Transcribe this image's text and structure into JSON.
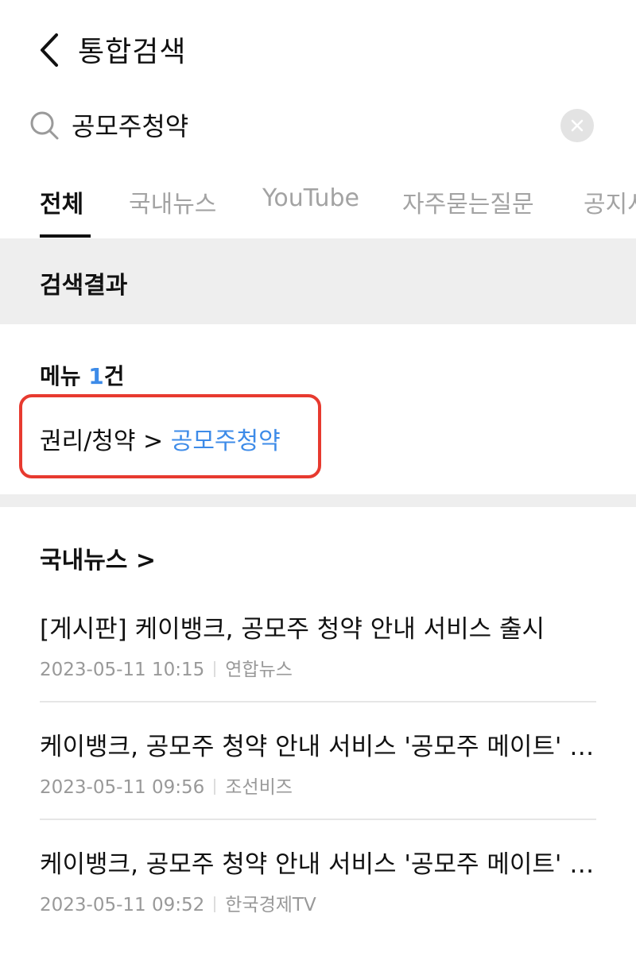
{
  "header": {
    "title": "통합검색"
  },
  "search": {
    "value": "공모주청약"
  },
  "tabs": [
    {
      "label": "전체",
      "active": true
    },
    {
      "label": "국내뉴스",
      "active": false
    },
    {
      "label": "YouTube",
      "active": false
    },
    {
      "label": "자주묻는질문",
      "active": false
    },
    {
      "label": "공지사",
      "active": false
    }
  ],
  "results": {
    "section_title": "검색결과",
    "menu": {
      "label": "메뉴",
      "count": "1",
      "count_suffix": "건",
      "path_prefix": "권리/청약 > ",
      "path_link": "공모주청약"
    }
  },
  "news": {
    "heading": "국내뉴스 >",
    "items": [
      {
        "title": "[게시판] 케이뱅크, 공모주 청약 안내 서비스 출시",
        "datetime": "2023-05-11 10:15",
        "source": "연합뉴스"
      },
      {
        "title": "케이뱅크, 공모주 청약 안내 서비스 '공모주 메이트' 출시",
        "datetime": "2023-05-11 09:56",
        "source": "조선비즈"
      },
      {
        "title": "케이뱅크, 공모주 청약 안내 서비스 '공모주 메이트' 출시",
        "datetime": "2023-05-11 09:52",
        "source": "한국경제TV"
      }
    ]
  },
  "colors": {
    "accent_blue": "#3d8be8",
    "highlight_red": "#e73a2f",
    "band_gray": "#eeeeee"
  },
  "icons": {
    "back": "chevron-left-icon",
    "search": "search-icon",
    "clear": "close-icon"
  }
}
